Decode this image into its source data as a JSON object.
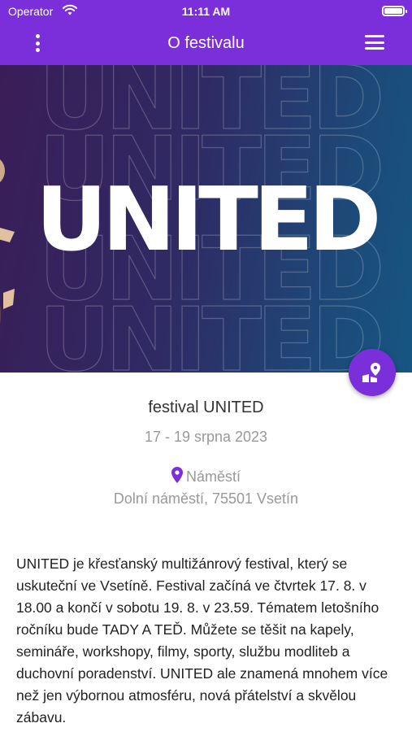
{
  "status_bar": {
    "carrier": "Operator",
    "time": "11:11 AM"
  },
  "nav": {
    "title": "O festivalu",
    "more_icon": "kebab-icon",
    "menu_icon": "hamburger-icon"
  },
  "hero": {
    "word": "UNITED"
  },
  "festival": {
    "name": "festival UNITED",
    "dates": "17 - 19 srpna 2023",
    "venue": "Náměstí",
    "address": "Dolní náměstí, 75501 Vsetín"
  },
  "description": "UNITED je křesťanský multižánrový festival, který se uskuteční ve Vsetíně. Festival začíná ve čtvrtek 17. 8. v 18.00 a končí v sobotu 19. 8. v 23.59. Tématem letošního ročníku bude TADY A TEĎ. Můžete se těšit na kapely, semináře, workshopy, filmy, sporty, službu modliteb a duchovní poradenství. UNITED ale znamená mnohem více než jen výbornou atmosféru, nová přátelství a skvělou zábavu.",
  "colors": {
    "accent": "#7b2fdb",
    "muted_text": "#999999"
  }
}
